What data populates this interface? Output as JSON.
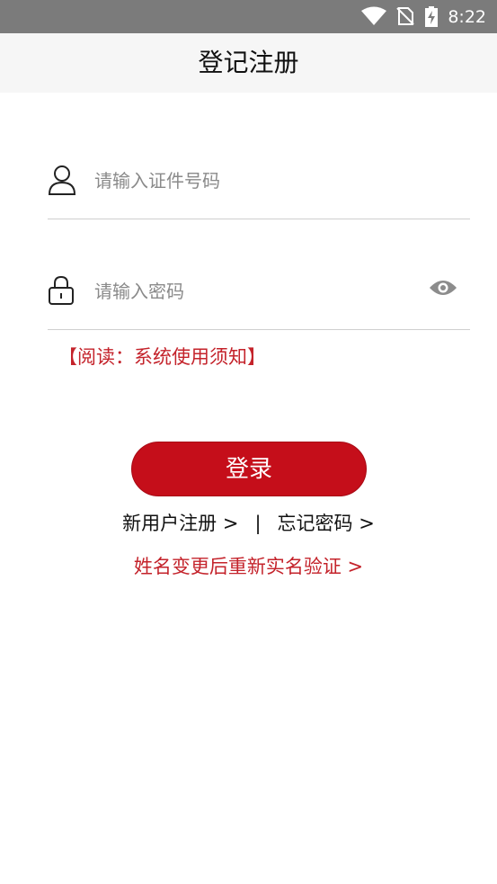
{
  "status_bar": {
    "time": "8:22"
  },
  "header": {
    "title": "登记注册"
  },
  "form": {
    "id_placeholder": "请输入证件号码",
    "password_placeholder": "请输入密码",
    "notice_link": "【阅读：系统使用须知】",
    "login_label": "登录"
  },
  "links": {
    "register": "新用户注册 >",
    "separator": "|",
    "forgot": "忘记密码 >",
    "reverify": "姓名变更后重新实名验证 >"
  },
  "colors": {
    "primary": "#c50e1a",
    "link_red": "#c4232b"
  }
}
